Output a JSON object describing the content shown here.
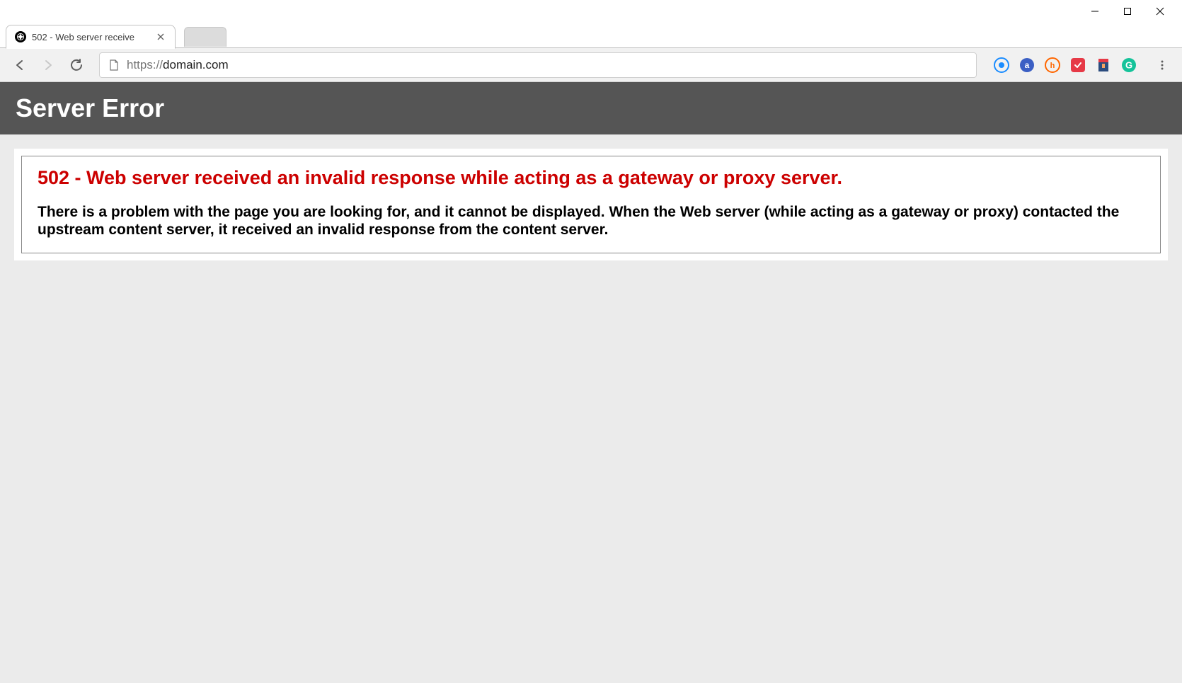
{
  "tab": {
    "title": "502 - Web server receive"
  },
  "address": {
    "protocol": "https://",
    "domain": "domain.com"
  },
  "page": {
    "header": "Server Error",
    "error_title": "502 - Web server received an invalid response while acting as a gateway or proxy server.",
    "error_description": "There is a problem with the page you are looking for, and it cannot be displayed. When the Web server (while acting as a gateway or proxy) contacted the upstream content server, it received an invalid response from the content server."
  }
}
